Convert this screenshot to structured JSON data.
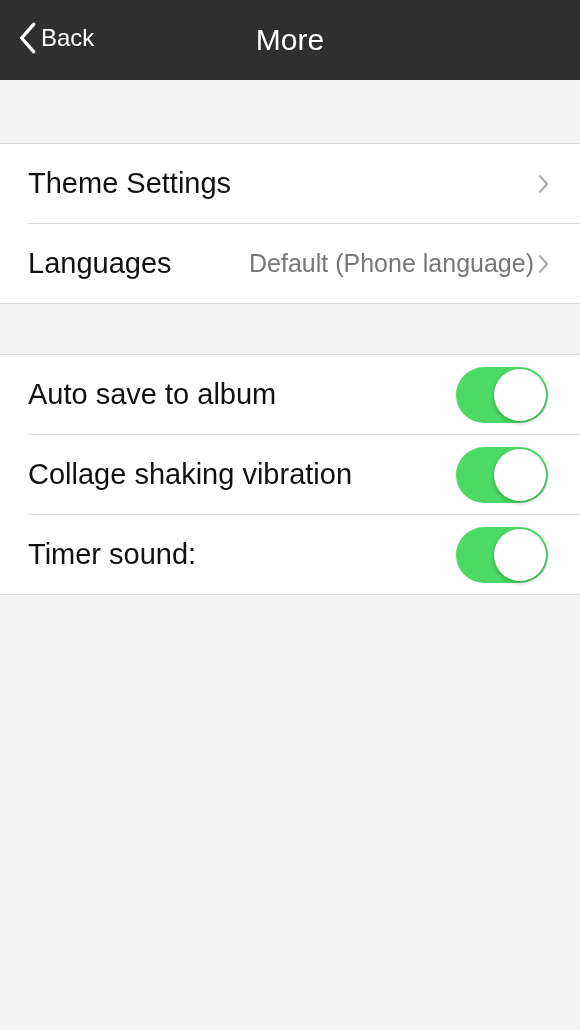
{
  "nav_bar": {
    "back_label": "Back",
    "title": "More"
  },
  "groups": [
    {
      "rows": [
        {
          "kind": "link",
          "label": "Theme Settings"
        },
        {
          "kind": "link",
          "label": "Languages",
          "value": "Default (Phone language)"
        }
      ]
    },
    {
      "rows": [
        {
          "kind": "toggle",
          "label": "Auto save to album",
          "on": true
        },
        {
          "kind": "toggle",
          "label": "Collage shaking vibration",
          "on": true
        },
        {
          "kind": "toggle",
          "label": "Timer sound:",
          "on": true
        }
      ]
    }
  ]
}
